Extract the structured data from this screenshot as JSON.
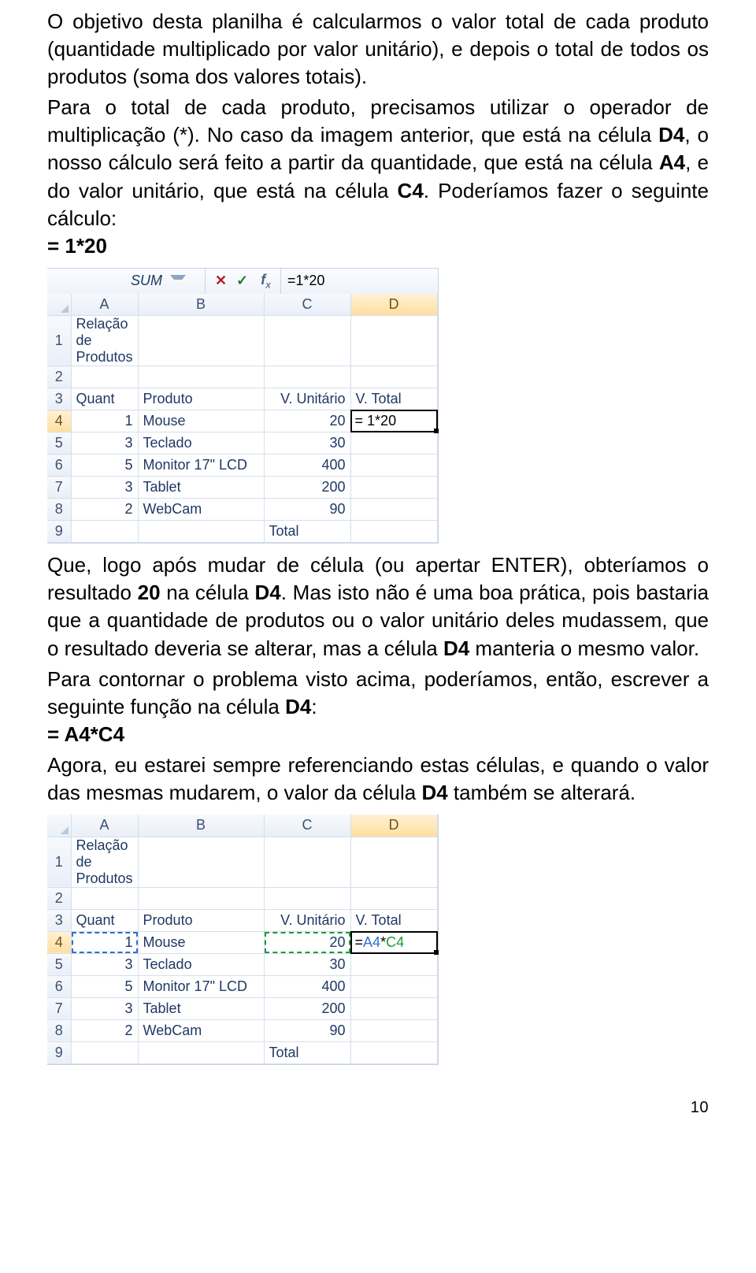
{
  "para1": {
    "t1": "O objetivo desta planilha é calcularmos o valor total de cada produto (quantidade multiplicado por valor unitário), e depois o total de todos os produtos (soma dos valores totais).",
    "t2_a": "Para o total de cada produto, precisamos utilizar o operador de multiplicação (*). No caso da imagem anterior, que está na célula ",
    "d4": "D4",
    "t2_b": ", o nosso cálculo será feito a partir da quantidade, que está na célula ",
    "a4": "A4",
    "t2_c": ", e do valor unitário, que está na célula ",
    "c4": "C4",
    "t2_d": ". Poderíamos fazer o seguinte cálculo:"
  },
  "code1": "= 1*20",
  "para2": {
    "t1_a": "Que, logo após mudar de célula (ou apertar ENTER), obteríamos o resultado ",
    "r20": "20",
    "t1_b": " na célula ",
    "d4": "D4",
    "t1_c": ". Mas isto não é uma boa prática, pois bastaria que a quantidade de produtos ou o valor unitário deles mudassem, que o resultado deveria se alterar, mas a célula ",
    "d4b": "D4",
    "t1_d": " manteria o mesmo valor.",
    "t2_a": "Para contornar o problema visto acima, poderíamos, então, escrever a seguinte função na célula ",
    "d4c": "D4",
    "t2_b": ":"
  },
  "code2": "= A4*C4",
  "para3": {
    "t1_a": "Agora, eu estarei sempre referenciando estas células, e quando o valor das mesmas mudarem, o valor da célula ",
    "d4": "D4",
    "t1_b": " também se alterará."
  },
  "page_number": "10",
  "xl_common": {
    "columns": [
      "A",
      "B",
      "C",
      "D"
    ],
    "rows": [
      "1",
      "2",
      "3",
      "4",
      "5",
      "6",
      "7",
      "8",
      "9"
    ],
    "data": {
      "title": "Relação de Produtos",
      "headers": {
        "A": "Quant",
        "B": "Produto",
        "C": "V. Unitário",
        "D": "V. Total"
      },
      "items": [
        {
          "q": "1",
          "p": "Mouse",
          "u": "20"
        },
        {
          "q": "3",
          "p": "Teclado",
          "u": "30"
        },
        {
          "q": "5",
          "p": "Monitor 17\" LCD",
          "u": "400"
        },
        {
          "q": "3",
          "p": "Tablet",
          "u": "200"
        },
        {
          "q": "2",
          "p": "WebCam",
          "u": "90"
        }
      ],
      "total_label": "Total"
    }
  },
  "xl1": {
    "namebox": "SUM",
    "formula": "=1*20",
    "active_display": "= 1*20"
  },
  "xl2": {
    "formula_prefix": "= ",
    "ref1": "A4",
    "op": "*",
    "ref2": "C4"
  },
  "chart_data": {
    "type": "table",
    "title": "Relação de Produtos",
    "columns": [
      "Quant",
      "Produto",
      "V. Unitário",
      "V. Total"
    ],
    "rows": [
      [
        1,
        "Mouse",
        20,
        null
      ],
      [
        3,
        "Teclado",
        30,
        null
      ],
      [
        5,
        "Monitor 17\" LCD",
        400,
        null
      ],
      [
        3,
        "Tablet",
        200,
        null
      ],
      [
        2,
        "WebCam",
        90,
        null
      ]
    ],
    "footer": [
      "",
      "",
      "Total",
      null
    ],
    "active_cell": "D4",
    "formulas_shown": [
      "=1*20",
      "= A4*C4"
    ]
  }
}
